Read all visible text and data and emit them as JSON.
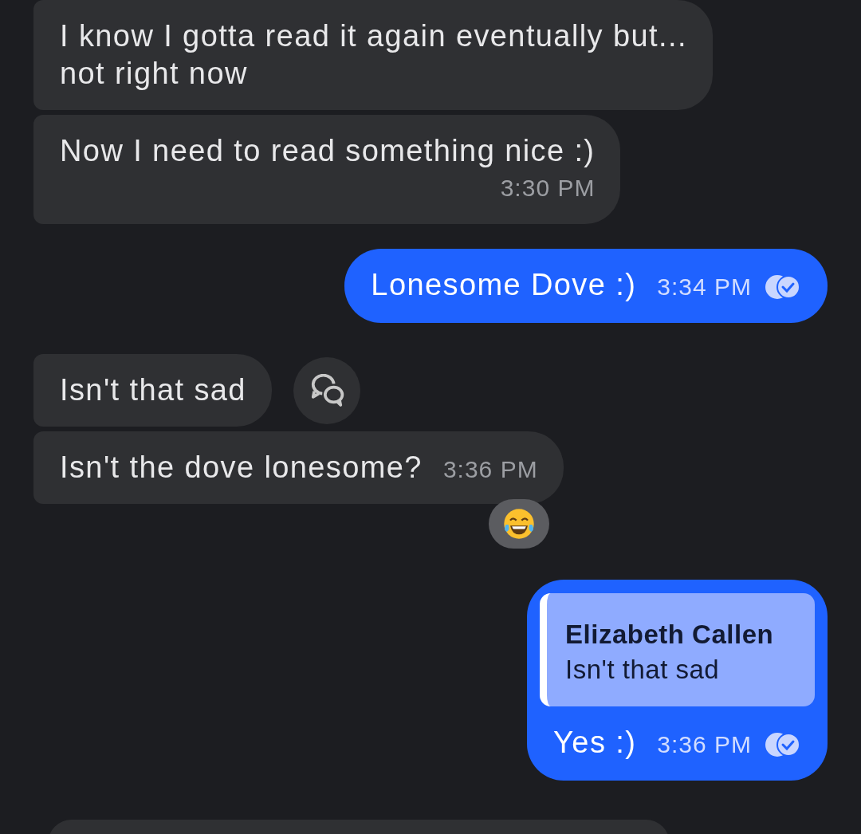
{
  "messages": [
    {
      "kind": "incoming",
      "text": "I know I gotta read it again eventually but...\nnot right now"
    },
    {
      "kind": "incoming",
      "text": "Now I need to read something nice :)",
      "time": "3:30 PM",
      "time_below": true
    },
    {
      "kind": "outgoing",
      "text": "Lonesome Dove :)",
      "time": "3:34 PM",
      "read": true
    },
    {
      "kind": "incoming",
      "text": "Isn't that sad",
      "reply_button": true
    },
    {
      "kind": "incoming",
      "text": "Isn't the dove lonesome?",
      "time": "3:36 PM",
      "reaction": true
    },
    {
      "kind": "outgoing",
      "quote": {
        "author": "Elizabeth Callen",
        "text": "Isn't that sad"
      },
      "text": "Yes :)",
      "time": "3:36 PM",
      "read": true
    },
    {
      "kind": "incoming"
    }
  ]
}
